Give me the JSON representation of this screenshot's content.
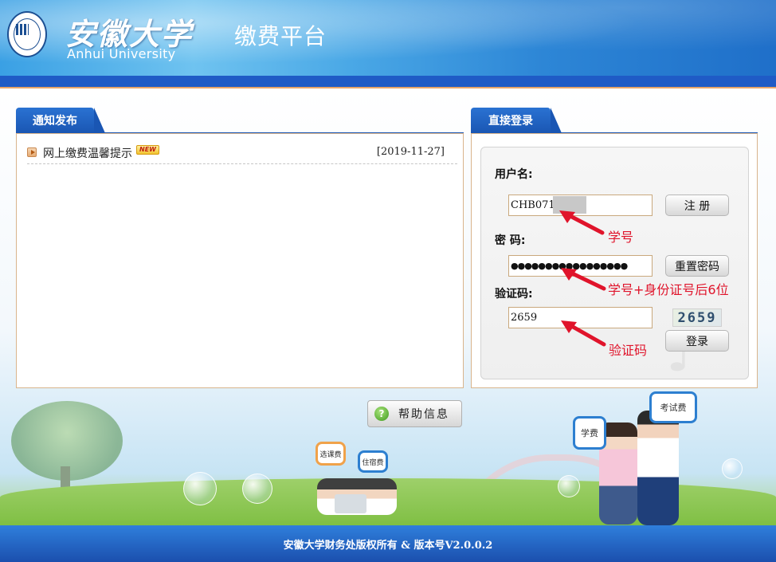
{
  "header": {
    "logo_cn": "安徽大学",
    "logo_en": "Anhui University",
    "site_title": "缴费平台"
  },
  "notice_panel": {
    "tab_label": "通知发布",
    "items": [
      {
        "title": "网上缴费温馨提示",
        "badge": "NEW",
        "date": "[2019-11-27]"
      }
    ]
  },
  "login_panel": {
    "tab_label": "直接登录",
    "username": {
      "label": "用户名:",
      "value": "CHB0719"
    },
    "password": {
      "label": "密 码:",
      "value": "●●●●●●●●●●●●●●●●●"
    },
    "captcha": {
      "label": "验证码:",
      "value": "2659",
      "image_text": "2659"
    },
    "register_button": "注 册",
    "reset_password_button": "重置密码",
    "login_button": "登录"
  },
  "annotations": {
    "username_hint": "学号",
    "password_hint": "学号+身份证号后6位",
    "captcha_hint": "验证码"
  },
  "scene": {
    "speech_tuition": "学费",
    "speech_exam_fee": "考试费",
    "speech_course_fee": "选课费",
    "speech_lodging_fee": "住宿费"
  },
  "help_button": {
    "label": "帮助信息",
    "icon": "question-icon"
  },
  "footer": {
    "text": "安徽大学财务处版权所有 & 版本号V2.0.0.2"
  },
  "colors": {
    "primary_blue": "#1a56b3",
    "annotation_red": "#e0142b",
    "panel_border": "#d9b48c"
  }
}
